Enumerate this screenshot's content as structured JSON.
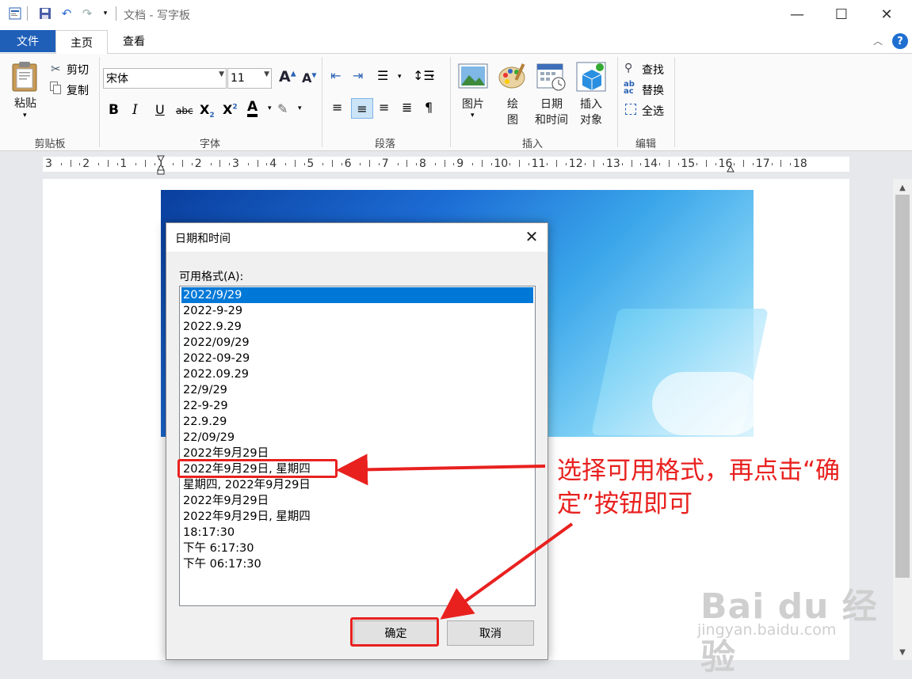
{
  "window": {
    "title": "文档 - 写字板"
  },
  "tabs": {
    "file": "文件",
    "home": "主页",
    "view": "查看"
  },
  "ribbon": {
    "clipboard": {
      "group": "剪贴板",
      "paste": "粘贴",
      "cut": "剪切",
      "copy": "复制"
    },
    "font": {
      "group": "字体",
      "family": "宋体",
      "size": "11"
    },
    "paragraph": {
      "group": "段落"
    },
    "insert": {
      "group": "插入",
      "picture": "图片",
      "paint_line1": "绘",
      "paint_line2": "图",
      "datetime_line1": "日期",
      "datetime_line2": "和时间",
      "object_line1": "插入",
      "object_line2": "对象"
    },
    "edit": {
      "group": "编辑",
      "find": "查找",
      "replace": "替换",
      "select_all": "全选"
    }
  },
  "ruler": {
    "ticks": [
      "3",
      "2",
      "1",
      "1",
      "2",
      "3",
      "4",
      "5",
      "6",
      "7",
      "8",
      "9",
      "10",
      "11",
      "12",
      "13",
      "14",
      "15",
      "16",
      "17",
      "18"
    ]
  },
  "dialog": {
    "title": "日期和时间",
    "formats_label": "可用格式(A):",
    "formats": [
      "2022/9/29",
      "2022-9-29",
      "2022.9.29",
      "2022/09/29",
      "2022-09-29",
      "2022.09.29",
      "22/9/29",
      "22-9-29",
      "22.9.29",
      "22/09/29",
      "2022年9月29日",
      "2022年9月29日, 星期四",
      "星期四, 2022年9月29日",
      "2022年9月29日",
      "2022年9月29日, 星期四",
      "18:17:30",
      "下午 6:17:30",
      "下午 06:17:30"
    ],
    "selected_index": 0,
    "ok": "确定",
    "cancel": "取消"
  },
  "annotation": {
    "text_line1": "选择可用格式，再点击“确",
    "text_line2": "定”按钮即可",
    "color": "#e8211f"
  },
  "watermark": {
    "line1": "Bai du 经验",
    "line2": "jingyan.baidu.com"
  }
}
